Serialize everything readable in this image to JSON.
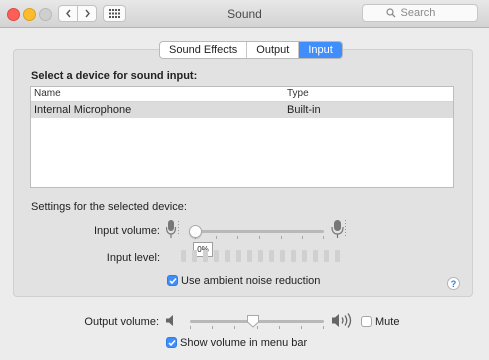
{
  "window": {
    "title": "Sound"
  },
  "search": {
    "placeholder": "Search"
  },
  "tabs": [
    {
      "label": "Sound Effects",
      "active": false
    },
    {
      "label": "Output",
      "active": false
    },
    {
      "label": "Input",
      "active": true
    }
  ],
  "input_panel": {
    "select_title": "Select a device for sound input:",
    "columns": {
      "name": "Name",
      "type": "Type"
    },
    "devices": [
      {
        "name": "Internal Microphone",
        "type": "Built-in",
        "selected": true
      }
    ],
    "settings_title": "Settings for the selected device:",
    "input_volume": {
      "label": "Input volume:",
      "value": 0.0,
      "value_display": "0%"
    },
    "input_level": {
      "label": "Input level:",
      "level": 0,
      "segments": 15
    },
    "ambient_noise": {
      "label": "Use ambient noise reduction",
      "checked": true
    }
  },
  "output": {
    "volume_label": "Output volume:",
    "volume": 0.47,
    "mute_label": "Mute",
    "mute_checked": false,
    "menu_bar_label": "Show volume in menu bar",
    "menu_bar_checked": true
  },
  "colors": {
    "accent": "#3f8efc",
    "close": "#fc5f57",
    "minimize": "#fdbc2e"
  },
  "icons": [
    "chevron-left-icon",
    "chevron-right-icon",
    "grid-icon",
    "search-icon",
    "microphone-icon",
    "speaker-low-icon",
    "speaker-high-icon",
    "help-icon",
    "checkmark-icon"
  ]
}
